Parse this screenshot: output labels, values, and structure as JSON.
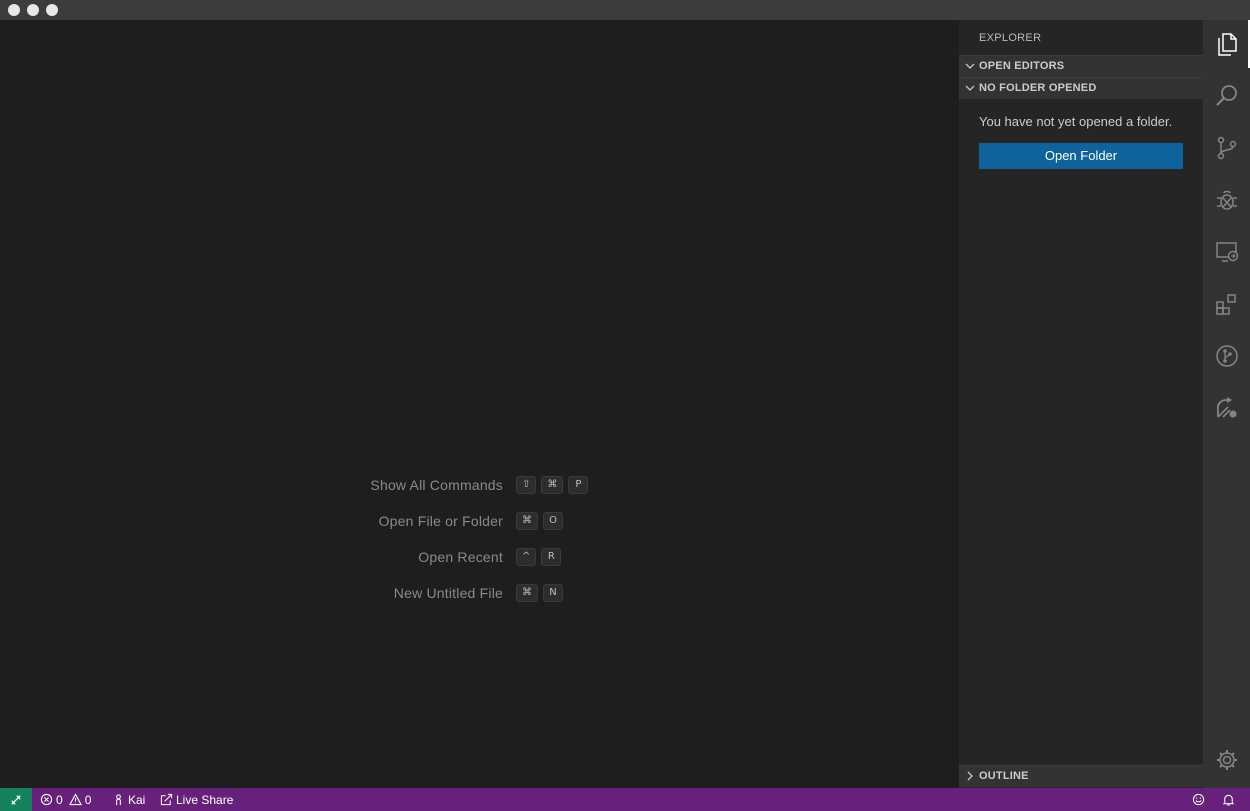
{
  "titlebar": {
    "buttons": [
      "close",
      "minimize",
      "zoom"
    ]
  },
  "editor": {
    "shortcuts": [
      {
        "label": "Show All Commands",
        "keys": [
          "⇧",
          "⌘",
          "P"
        ]
      },
      {
        "label": "Open File or Folder",
        "keys": [
          "⌘",
          "O"
        ]
      },
      {
        "label": "Open Recent",
        "keys": [
          "^",
          "R"
        ]
      },
      {
        "label": "New Untitled File",
        "keys": [
          "⌘",
          "N"
        ]
      }
    ]
  },
  "sidebar": {
    "title": "EXPLORER",
    "sections": {
      "open_editors": "OPEN EDITORS",
      "no_folder": "NO FOLDER OPENED",
      "outline": "OUTLINE"
    },
    "empty_message": "You have not yet opened a folder.",
    "open_folder_button": "Open Folder"
  },
  "activity_bar": {
    "items": [
      "files-icon",
      "search-icon",
      "source-control-icon",
      "debug-icon",
      "remote-explorer-icon",
      "extensions-icon",
      "git-graph-icon",
      "live-share-icon"
    ],
    "settings": "gear-icon"
  },
  "statusbar": {
    "errors": "0",
    "warnings": "0",
    "user": "Kai",
    "live_share": "Live Share"
  },
  "colors": {
    "editor_bg": "#1e1e1e",
    "sidebar_bg": "#252526",
    "activity_bg": "#333333",
    "statusbar_bg": "#68217a",
    "remote_bg": "#16825d",
    "button_bg": "#0e639c"
  }
}
